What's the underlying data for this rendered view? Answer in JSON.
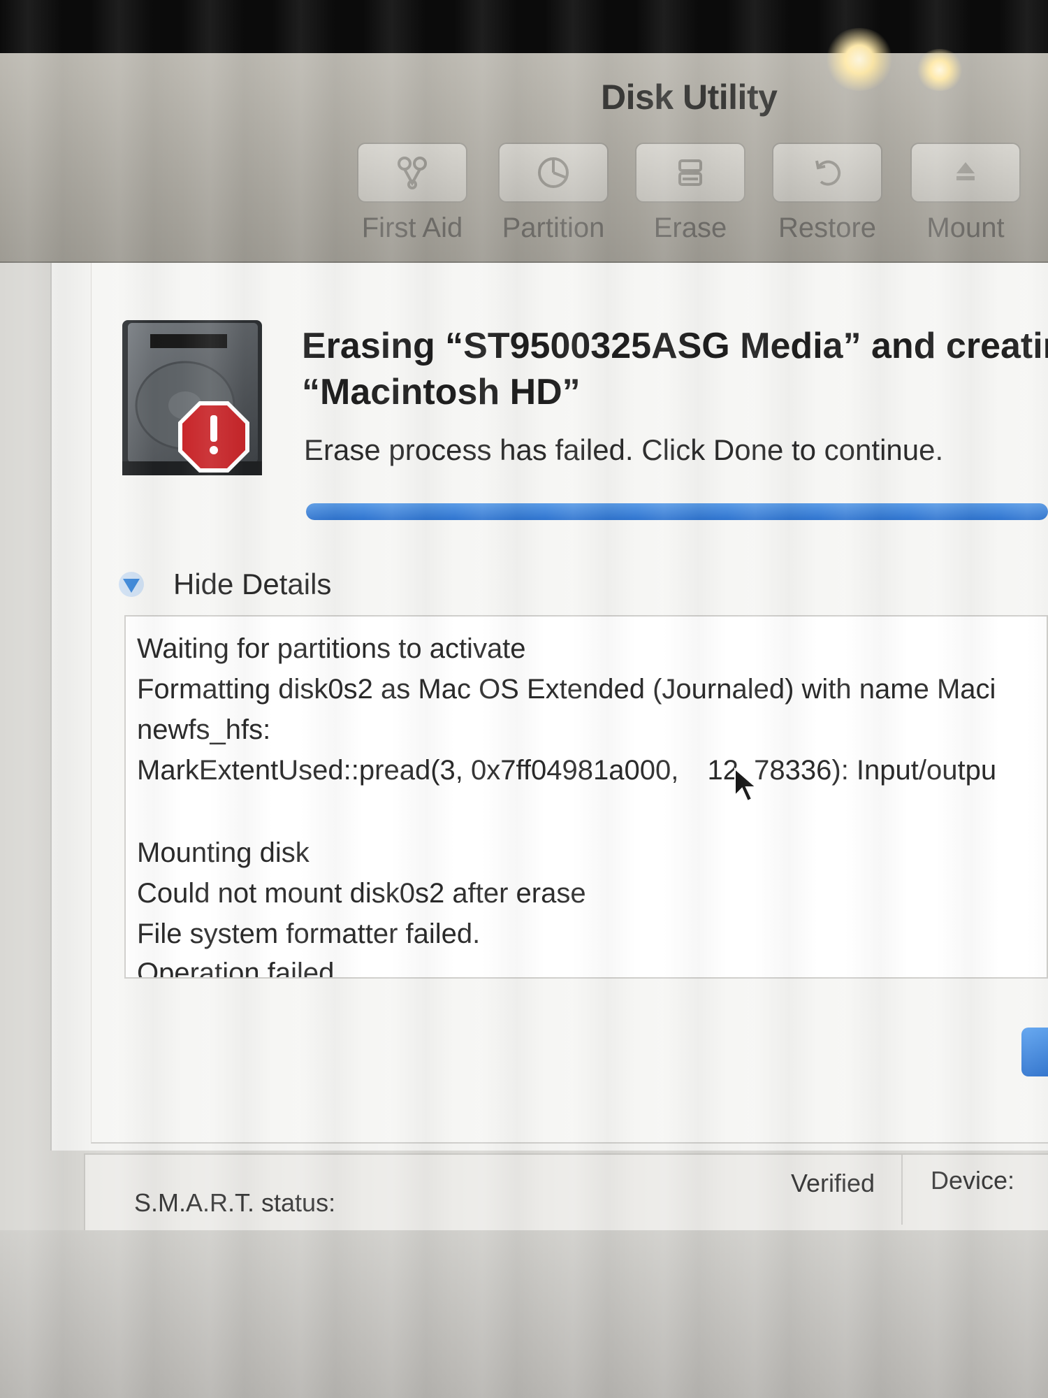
{
  "window": {
    "title": "Disk Utility"
  },
  "toolbar": {
    "first_aid": "First Aid",
    "partition": "Partition",
    "erase": "Erase",
    "restore": "Restore",
    "mount": "Mount"
  },
  "dialog": {
    "heading_line1": "Erasing “ST9500325ASG Media” and creatin",
    "heading_line2": "“Macintosh HD”",
    "message": "Erase process has failed. Click Done to continue.",
    "progress": 1.0,
    "details_toggle": "Hide Details",
    "log": [
      "Waiting for partitions to activate",
      "Formatting disk0s2 as Mac OS Extended (Journaled) with name Maci",
      "newfs_hfs:",
      "MarkExtentUsed::pread(3, 0x7ff04981a000, ",
      "12, 78336): Input/outpu",
      "Mounting disk",
      "Could not mount disk0s2 after erase",
      "File system formatter failed.",
      "Operation failed..."
    ]
  },
  "status": {
    "smart_label": "S.M.A.R.T. status:",
    "smart_value": "Verified",
    "device_label": "Device:"
  },
  "colors": {
    "accent_blue": "#2f74cf",
    "error_red": "#c8262a"
  },
  "icons": {
    "disk": "hard-disk-icon",
    "error": "error-stop-icon",
    "details": "triangle-down-icon"
  }
}
